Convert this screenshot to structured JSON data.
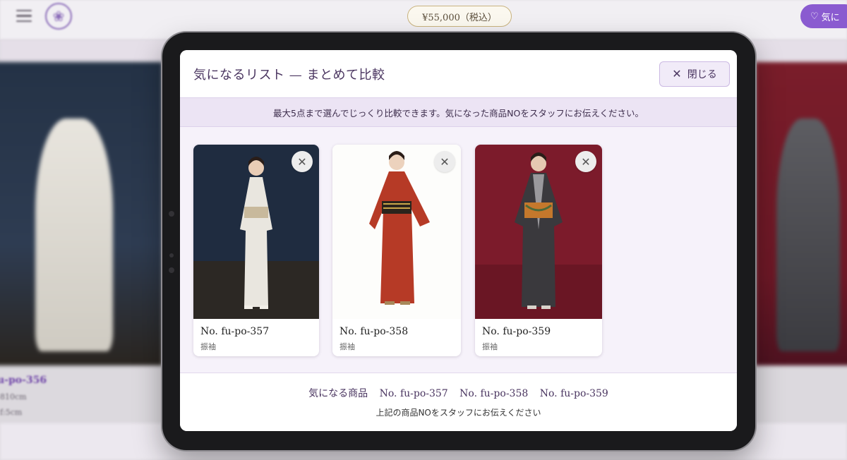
{
  "background_page": {
    "price_label": "¥55,000（税込）",
    "favorite_button_label": "気に",
    "product_no_partial": "u-po-356",
    "detail_line_1": "810cm",
    "detail_line_2": "f:5cm"
  },
  "modal": {
    "title": "気になるリスト — まとめて比較",
    "close_label": "閉じる",
    "notice": "最大5点まで選んでじっくり比較できます。気になった商品NOをスタッフにお伝えください。",
    "items": [
      {
        "product_no": "No. fu-po-357",
        "category": "振袖",
        "colors": {
          "bg": "#1f2c40",
          "floor": "#2c2824",
          "kimono": "#e9e6df",
          "obi": "#c8b99c"
        }
      },
      {
        "product_no": "No. fu-po-358",
        "category": "振袖",
        "colors": {
          "bg": "#fdfdfb",
          "floor": "#fdfdfb",
          "kimono": "#b63a26",
          "obi": "#2a241c"
        }
      },
      {
        "product_no": "No. fu-po-359",
        "category": "振袖",
        "colors": {
          "bg": "#7c1b2b",
          "floor": "#6a1624",
          "kimono": "#3a393d",
          "obi": "#c4782c"
        }
      }
    ],
    "footer": {
      "favorites_label": "気になる商品",
      "favorites": [
        "No. fu-po-357",
        "No. fu-po-358",
        "No. fu-po-359"
      ],
      "note": "上記の商品NOをスタッフにお伝えください"
    }
  },
  "colors": {
    "accent_purple": "#8a5bd0",
    "title_purple": "#4a3560",
    "notice_bg": "#ece4f4"
  }
}
